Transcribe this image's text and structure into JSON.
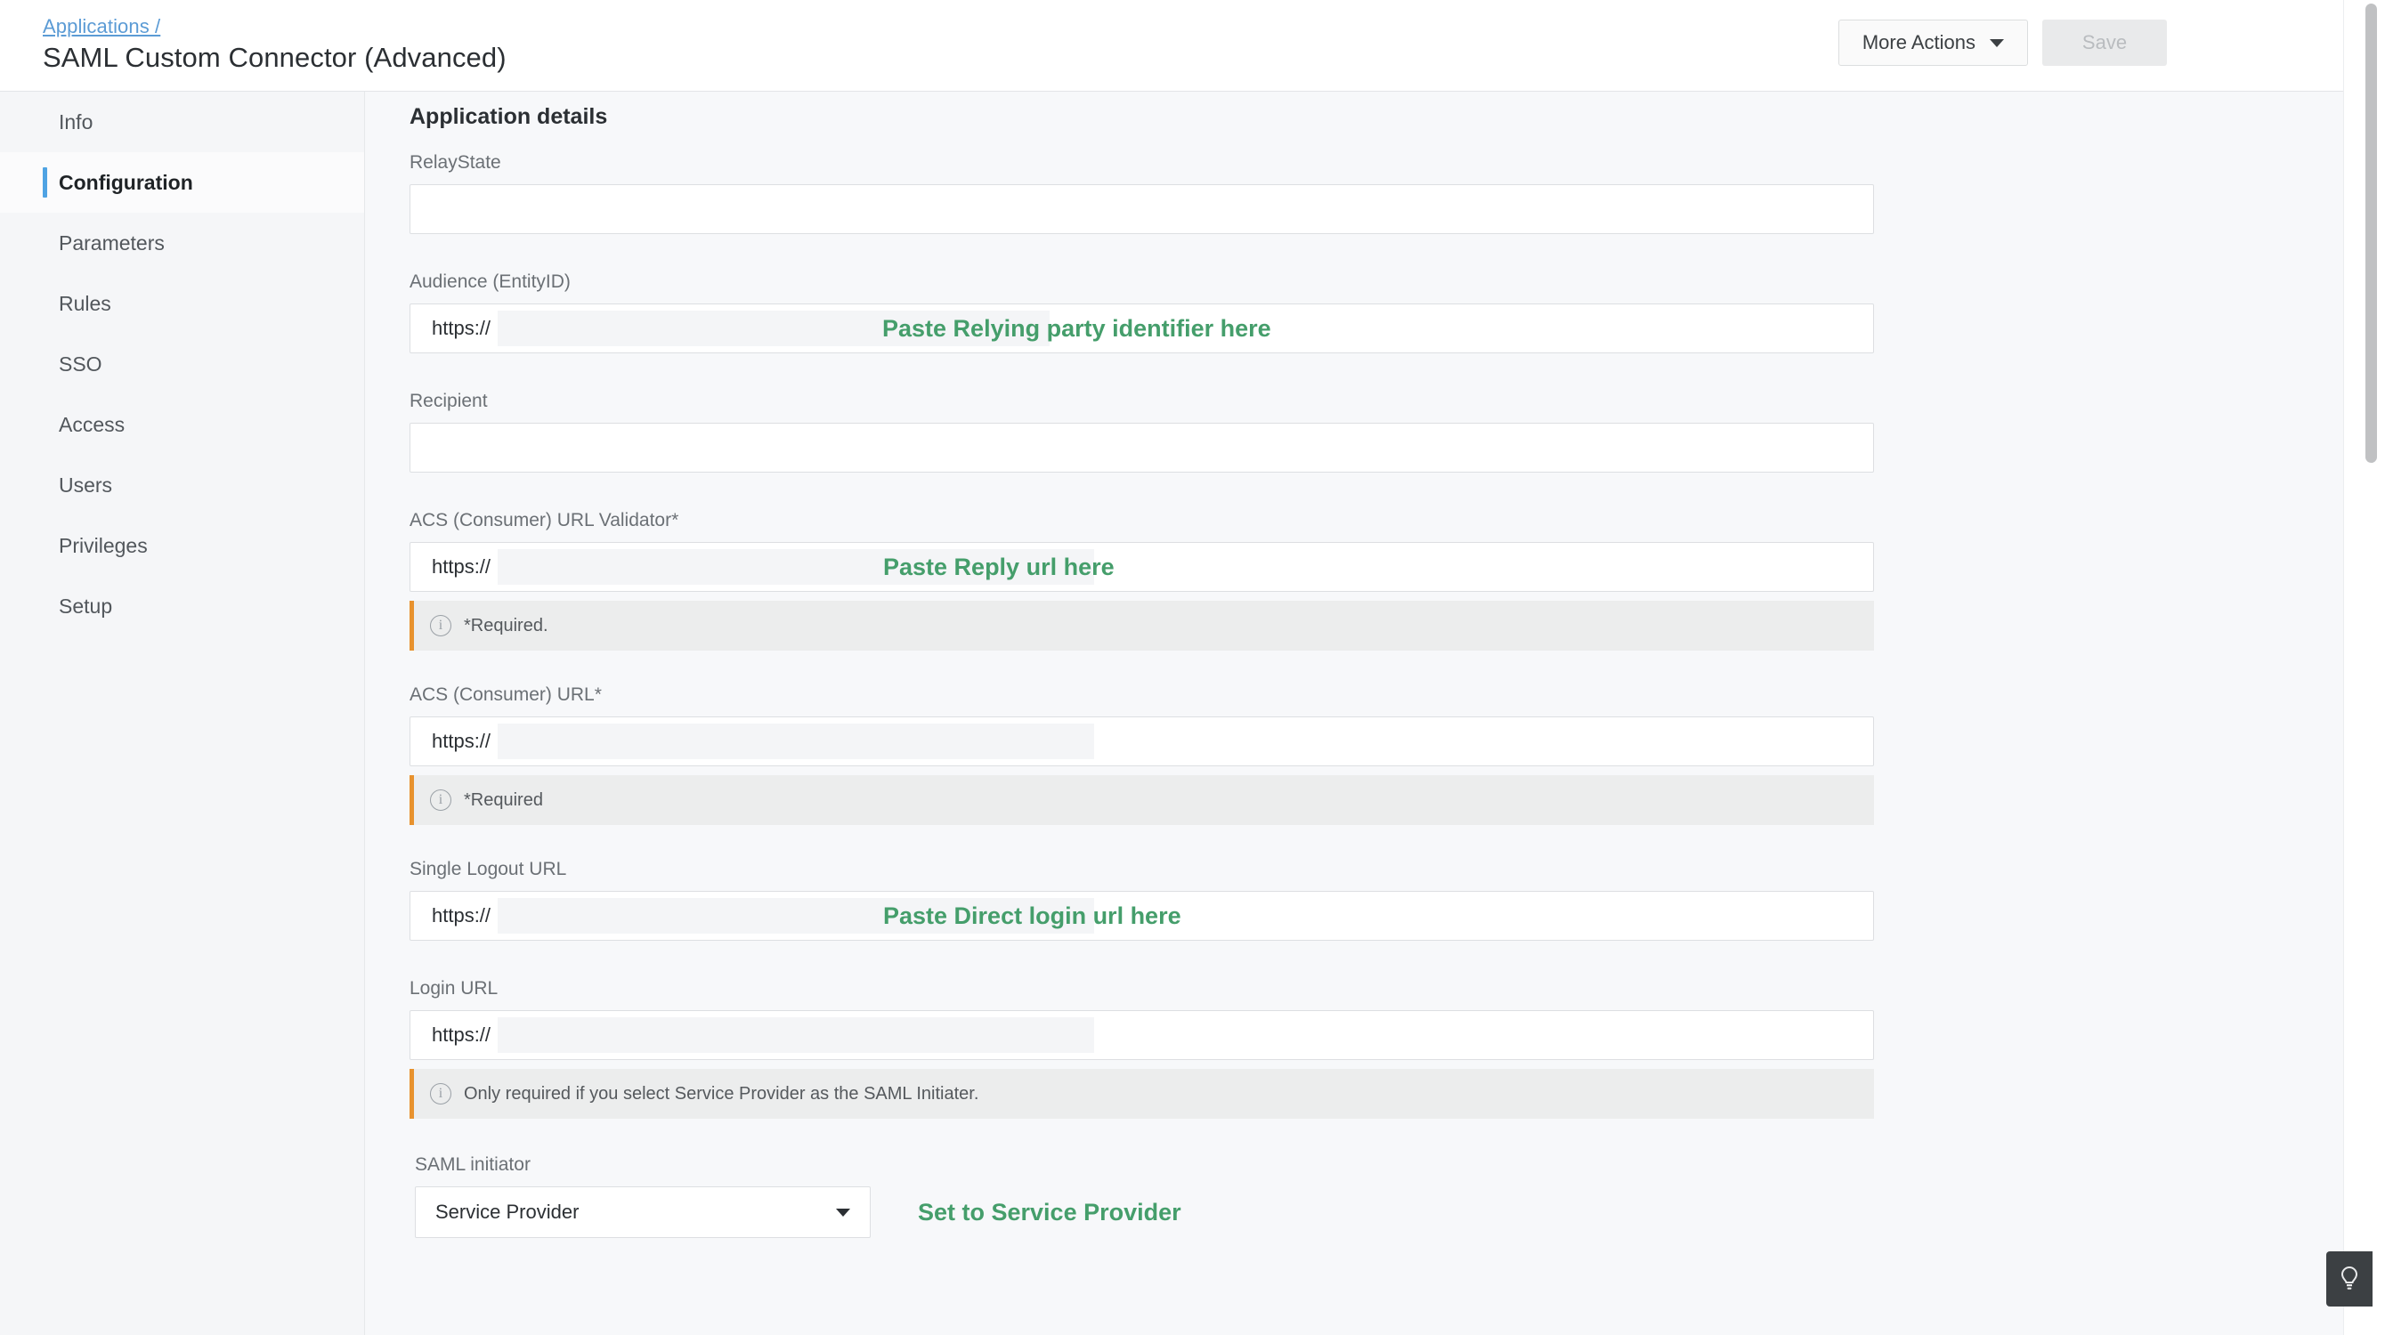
{
  "header": {
    "breadcrumb": "Applications /",
    "title": "SAML Custom Connector (Advanced)",
    "more_actions_label": "More Actions",
    "save_label": "Save"
  },
  "sidebar": {
    "items": [
      {
        "label": "Info",
        "active": false
      },
      {
        "label": "Configuration",
        "active": true
      },
      {
        "label": "Parameters",
        "active": false
      },
      {
        "label": "Rules",
        "active": false
      },
      {
        "label": "SSO",
        "active": false
      },
      {
        "label": "Access",
        "active": false
      },
      {
        "label": "Users",
        "active": false
      },
      {
        "label": "Privileges",
        "active": false
      },
      {
        "label": "Setup",
        "active": false
      }
    ]
  },
  "main": {
    "section_title": "Application details",
    "fields": {
      "relay_state": {
        "label": "RelayState",
        "value": "",
        "prefix": ""
      },
      "audience": {
        "label": "Audience (EntityID)",
        "prefix": "https://",
        "value": "",
        "annotation": "Paste Relying party identifier here"
      },
      "recipient": {
        "label": "Recipient",
        "value": "",
        "prefix": ""
      },
      "acs_validator": {
        "label": "ACS (Consumer) URL Validator*",
        "prefix": "https://",
        "value": "",
        "annotation": "Paste Reply url here",
        "hint": "*Required."
      },
      "acs_url": {
        "label": "ACS (Consumer) URL*",
        "prefix": "https://",
        "value": "",
        "hint": "*Required"
      },
      "single_logout": {
        "label": "Single Logout URL",
        "prefix": "https://",
        "value": "",
        "annotation": "Paste Direct login url here"
      },
      "login_url": {
        "label": "Login URL",
        "prefix": "https://",
        "value": "",
        "hint": "Only required if you select Service Provider as the SAML Initiater."
      },
      "saml_initiator": {
        "label": "SAML initiator",
        "selected": "Service Provider",
        "annotation": "Set to Service Provider"
      }
    }
  },
  "colors": {
    "annotation_green": "#459e6b",
    "active_indicator_blue": "#4fa3e3",
    "hint_accent_orange": "#e8922e",
    "breadcrumb_link": "#5b9bd5"
  },
  "icons": {
    "more_actions_caret": "chevron-down-icon",
    "select_caret": "chevron-down-icon",
    "hint_info": "info-circle-icon",
    "help": "lightbulb-icon"
  }
}
